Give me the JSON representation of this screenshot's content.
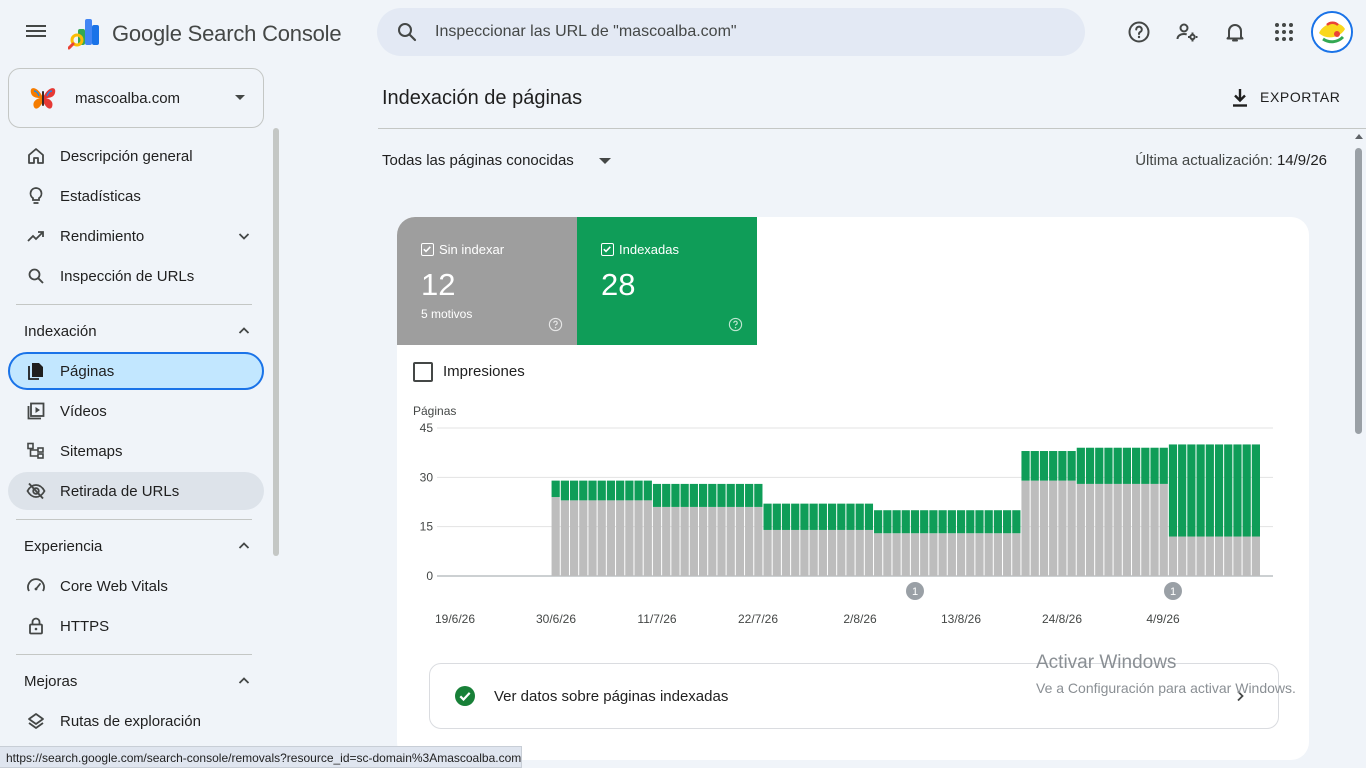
{
  "header": {
    "brand": "Google Search Console",
    "search_placeholder": "Inspeccionar las URL de \"mascoalba.com\"",
    "icons": [
      "help-icon",
      "manage-accounts-icon",
      "notifications-icon",
      "apps-icon"
    ]
  },
  "property": {
    "name": "mascoalba.com"
  },
  "sidebar": {
    "items": [
      {
        "label": "Descripción general",
        "icon": "home-icon"
      },
      {
        "label": "Estadísticas",
        "icon": "lightbulb-icon"
      },
      {
        "label": "Rendimiento",
        "icon": "trending-up-icon"
      },
      {
        "label": "Inspección de URLs",
        "icon": "search-icon"
      }
    ],
    "sections": [
      {
        "title": "Indexación",
        "items": [
          {
            "label": "Páginas",
            "icon": "pages-icon"
          },
          {
            "label": "Vídeos",
            "icon": "video-icon"
          },
          {
            "label": "Sitemaps",
            "icon": "sitemap-icon"
          },
          {
            "label": "Retirada de URLs",
            "icon": "visibility-off-icon"
          }
        ]
      },
      {
        "title": "Experiencia",
        "items": [
          {
            "label": "Core Web Vitals",
            "icon": "speed-icon"
          },
          {
            "label": "HTTPS",
            "icon": "lock-icon"
          }
        ]
      },
      {
        "title": "Mejoras",
        "items": [
          {
            "label": "Rutas de exploración",
            "icon": "layers-icon"
          }
        ]
      }
    ]
  },
  "main": {
    "title": "Indexación de páginas",
    "export_label": "EXPORTAR",
    "filter_label": "Todas las páginas conocidas",
    "updated_label": "Última actualización:",
    "updated_value": "14/9/26",
    "tiles": [
      {
        "label": "Sin indexar",
        "value": "12",
        "sub": "5 motivos",
        "color": "#9e9e9e"
      },
      {
        "label": "Indexadas",
        "value": "28",
        "sub": "",
        "color": "#0f9d58"
      }
    ],
    "impressions_label": "Impresiones",
    "link_label": "Ver datos sobre páginas indexadas"
  },
  "chart_data": {
    "type": "bar",
    "stacked": true,
    "ylabel": "Páginas",
    "yticks": [
      "45",
      "30",
      "15",
      "0"
    ],
    "ylim": [
      0,
      45
    ],
    "xticks": [
      "19/6/26",
      "30/6/26",
      "11/7/26",
      "22/7/26",
      "2/8/26",
      "13/8/26",
      "24/8/26",
      "4/9/26"
    ],
    "annotations": [
      "1",
      "1"
    ],
    "series": [
      {
        "name": "Sin indexar",
        "color": "#bdbdbd",
        "values": [
          0,
          0,
          0,
          0,
          0,
          0,
          0,
          0,
          0,
          0,
          0,
          0,
          24,
          23,
          23,
          23,
          23,
          23,
          23,
          23,
          23,
          23,
          23,
          21,
          21,
          21,
          21,
          21,
          21,
          21,
          21,
          21,
          21,
          21,
          21,
          14,
          14,
          14,
          14,
          14,
          14,
          14,
          14,
          14,
          14,
          14,
          14,
          13,
          13,
          13,
          13,
          13,
          13,
          13,
          13,
          13,
          13,
          13,
          13,
          13,
          13,
          13,
          13,
          29,
          29,
          29,
          29,
          29,
          29,
          28,
          28,
          28,
          28,
          28,
          28,
          28,
          28,
          28,
          28,
          12,
          12,
          12,
          12,
          12,
          12,
          12,
          12,
          12,
          12
        ]
      },
      {
        "name": "Indexadas",
        "color": "#0f9d58",
        "values": [
          0,
          0,
          0,
          0,
          0,
          0,
          0,
          0,
          0,
          0,
          0,
          0,
          5,
          6,
          6,
          6,
          6,
          6,
          6,
          6,
          6,
          6,
          6,
          7,
          7,
          7,
          7,
          7,
          7,
          7,
          7,
          7,
          7,
          7,
          7,
          8,
          8,
          8,
          8,
          8,
          8,
          8,
          8,
          8,
          8,
          8,
          8,
          7,
          7,
          7,
          7,
          7,
          7,
          7,
          7,
          7,
          7,
          7,
          7,
          7,
          7,
          7,
          7,
          9,
          9,
          9,
          9,
          9,
          9,
          11,
          11,
          11,
          11,
          11,
          11,
          11,
          11,
          11,
          11,
          28,
          28,
          28,
          28,
          28,
          28,
          28,
          28,
          28,
          28
        ]
      }
    ]
  },
  "statusbar": {
    "url": "https://search.google.com/search-console/removals?resource_id=sc-domain%3Amascoalba.com"
  },
  "watermark": {
    "line1": "Activar Windows",
    "line2": "Ve a Configuración para activar Windows."
  }
}
